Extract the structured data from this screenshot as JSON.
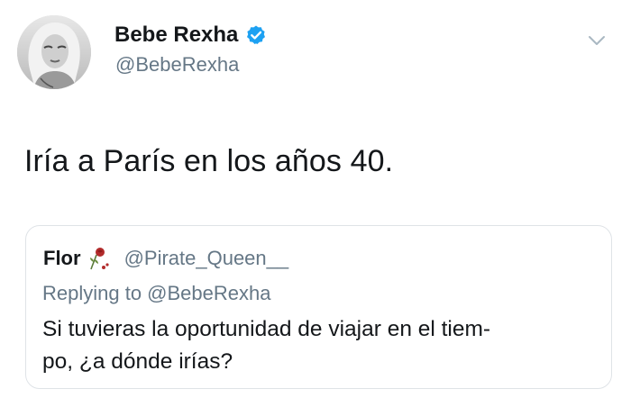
{
  "tweet": {
    "author": {
      "display_name": "Bebe Rexha",
      "handle": "@BebeRexha",
      "verified_icon": "verified-badge-icon",
      "avatar_icon": "profile-avatar"
    },
    "menu_icon": "chevron-down-icon",
    "text": "Iría a París en los años 40."
  },
  "quoted_tweet": {
    "author_name": "Flor",
    "author_emoji": "wilted-rose-icon",
    "author_handle": "@Pirate_Queen__",
    "replying_to": "Replying to @BebeRexha",
    "text_lines": [
      "Si tuvieras la oportunidad de viajar en el tiem-",
      "po, ¿a dónde irías?"
    ]
  },
  "colors": {
    "text_primary": "#14171a",
    "text_secondary": "#657786",
    "verified_blue": "#1da1f2",
    "border": "#dfe3e7"
  }
}
